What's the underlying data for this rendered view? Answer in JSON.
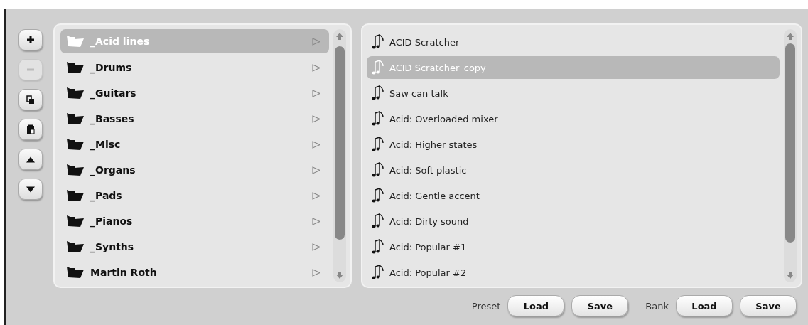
{
  "toolbar": [
    {
      "kind": "add",
      "disabled": false
    },
    {
      "kind": "remove",
      "disabled": true
    },
    {
      "kind": "copy",
      "disabled": false
    },
    {
      "kind": "paste",
      "disabled": false
    },
    {
      "kind": "up",
      "disabled": false
    },
    {
      "kind": "down",
      "disabled": false
    }
  ],
  "folders": [
    {
      "label": "_Acid lines",
      "selected": true
    },
    {
      "label": "_Drums",
      "selected": false
    },
    {
      "label": "_Guitars",
      "selected": false
    },
    {
      "label": "_Basses",
      "selected": false
    },
    {
      "label": "_Misc",
      "selected": false
    },
    {
      "label": "_Organs",
      "selected": false
    },
    {
      "label": "_Pads",
      "selected": false
    },
    {
      "label": "_Pianos",
      "selected": false
    },
    {
      "label": "_Synths",
      "selected": false
    },
    {
      "label": "Martin Roth",
      "selected": false
    }
  ],
  "presets": [
    {
      "label": "ACID Scratcher",
      "selected": false
    },
    {
      "label": "ACID Scratcher_copy",
      "selected": true
    },
    {
      "label": "Saw can talk",
      "selected": false
    },
    {
      "label": "Acid: Overloaded mixer",
      "selected": false
    },
    {
      "label": "Acid: Higher states",
      "selected": false
    },
    {
      "label": "Acid: Soft plastic",
      "selected": false
    },
    {
      "label": "Acid: Gentle accent",
      "selected": false
    },
    {
      "label": "Acid: Dirty sound",
      "selected": false
    },
    {
      "label": "Acid: Popular #1",
      "selected": false
    },
    {
      "label": "Acid: Popular #2",
      "selected": false
    }
  ],
  "footer": {
    "preset_label": "Preset",
    "preset_buttons": [
      "Load",
      "Save"
    ],
    "bank_label": "Bank",
    "bank_buttons": [
      "Load",
      "Save"
    ]
  }
}
